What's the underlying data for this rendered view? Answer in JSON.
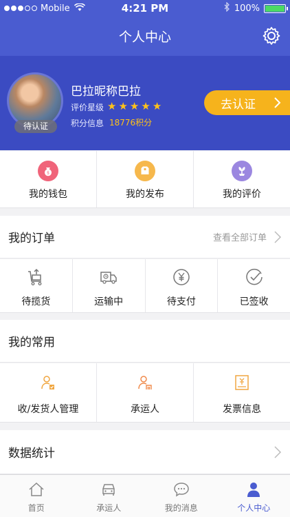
{
  "status_bar": {
    "carrier": "Mobile",
    "time": "4:21 PM",
    "battery": "100%"
  },
  "header": {
    "title": "个人中心"
  },
  "profile": {
    "nickname": "巴拉昵称巴拉",
    "cert_tag": "待认证",
    "rating_label": "评价星级",
    "rating_stars": 5,
    "points_label": "积分信息",
    "points_value": "18776积分",
    "verify_button": "去认证"
  },
  "quick_actions": [
    {
      "label": "我的钱包",
      "color": "#f0647a"
    },
    {
      "label": "我的发布",
      "color": "#f6b84c"
    },
    {
      "label": "我的评价",
      "color": "#9b87e0"
    }
  ],
  "orders": {
    "title": "我的订单",
    "more_link": "查看全部订单",
    "items": [
      "待揽货",
      "运输中",
      "待支付",
      "已签收"
    ]
  },
  "common": {
    "title": "我的常用",
    "items": [
      "收/发货人管理",
      "承运人",
      "发票信息"
    ]
  },
  "stats": {
    "title": "数据统计"
  },
  "tabs": [
    {
      "label": "首页",
      "active": false
    },
    {
      "label": "承运人",
      "active": false
    },
    {
      "label": "我的消息",
      "active": false
    },
    {
      "label": "个人中心",
      "active": true
    }
  ],
  "colors": {
    "primary": "#4a5cd0",
    "banner": "#3b4bc2",
    "accent": "#f6b31c",
    "orange_icon": "#f08a4b"
  }
}
